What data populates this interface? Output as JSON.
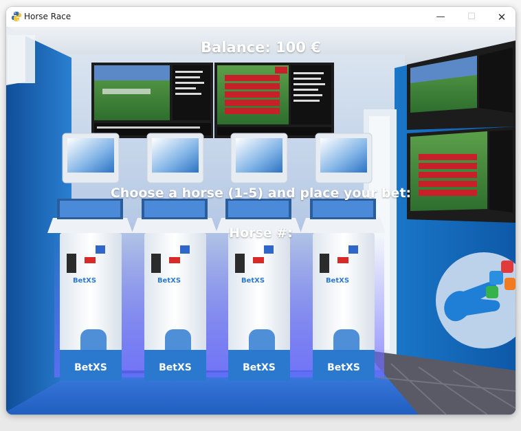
{
  "window": {
    "title": "Horse Race",
    "minimize_glyph": "—",
    "maximize_glyph": "☐",
    "close_glyph": "✕"
  },
  "game": {
    "balance_text": "Balance: 100 €",
    "prompt_text": "Choose a horse (1-5) and place your bet:",
    "horse_label": "Horse #:"
  },
  "background": {
    "brand_text": "BetXS",
    "colors": {
      "wall_blue": "#1b6fc4",
      "floor_blue": "#2f6fd2",
      "kiosk_white": "#f3f6fa",
      "screen_green": "#2e8a3c",
      "screen_red": "#c8202b"
    }
  }
}
